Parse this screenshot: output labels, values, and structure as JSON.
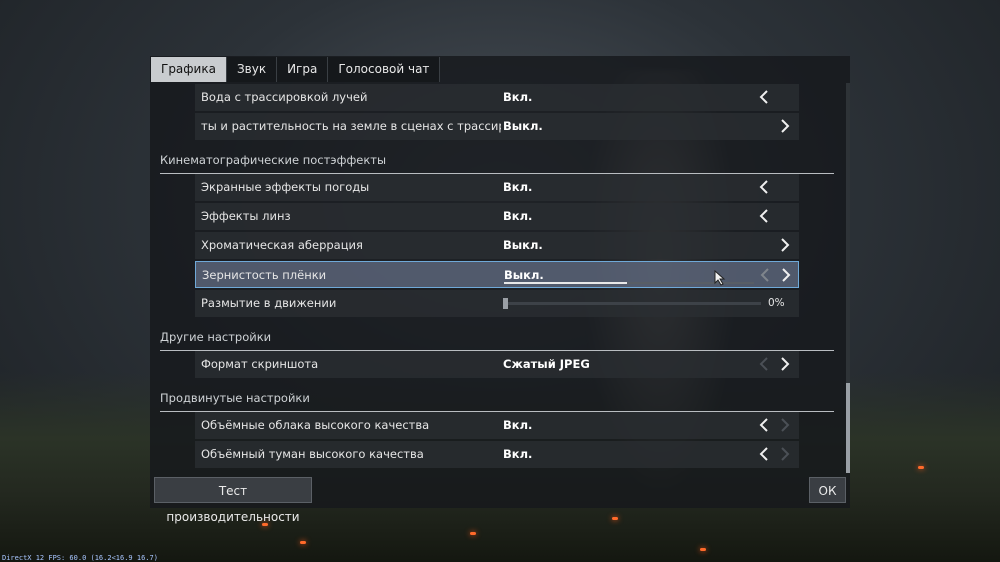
{
  "tabs": [
    "Графика",
    "Звук",
    "Игра",
    "Голосовой чат"
  ],
  "rows_top": [
    {
      "label": "Вода с трассировкой лучей",
      "value": "Вкл.",
      "left_arrow": true,
      "right_arrow": false
    },
    {
      "label": "ты и растительность на земле в сценах с трассировкой",
      "value": "Выкл.",
      "left_arrow": false,
      "right_arrow": true
    }
  ],
  "sections": {
    "cinematic": "Кинематографические постэффекты",
    "other": "Другие настройки",
    "advanced": "Продвинутые настройки"
  },
  "cinematic_rows": [
    {
      "label": "Экранные эффекты погоды",
      "value": "Вкл."
    },
    {
      "label": "Эффекты линз",
      "value": "Вкл."
    },
    {
      "label": "Хроматическая аберрация",
      "value": "Выкл."
    },
    {
      "label": "Зернистость плёнки",
      "value": "Выкл.",
      "progress": 0.49
    },
    {
      "label": "Размытие в движении",
      "slider_value": "0%",
      "slider_fraction": 0
    }
  ],
  "other_rows": [
    {
      "label": "Формат скриншота",
      "value": "Сжатый JPEG"
    }
  ],
  "advanced_rows": [
    {
      "label": "Объёмные облака высокого качества",
      "value": "Вкл."
    },
    {
      "label": "Объёмный туман высокого качества",
      "value": "Вкл."
    }
  ],
  "buttons": {
    "benchmark": "Тест производительности",
    "ok": "ОК"
  },
  "fps_text": "DirectX 12 FPS: 60.0 (16.2<16.9 16.7)",
  "colors": {
    "selected_border": "#6fa9d8",
    "active_tab": "#c9cccf"
  }
}
